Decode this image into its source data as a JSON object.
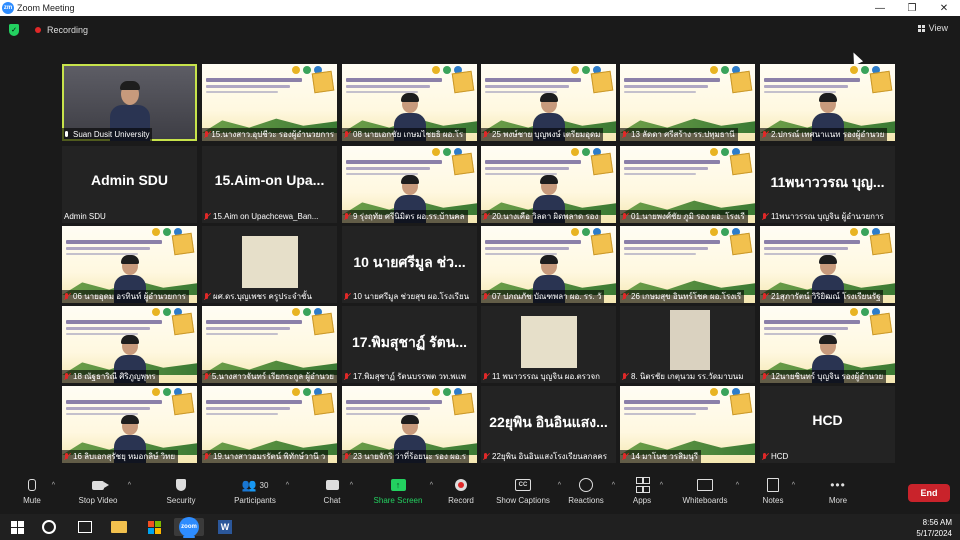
{
  "window": {
    "logo_text": "zm",
    "title": "Zoom Meeting",
    "minimize": "—",
    "restore": "❐",
    "close": "✕"
  },
  "topbar": {
    "recording": "Recording",
    "view": "View"
  },
  "tiles": [
    {
      "type": "cam",
      "big": "",
      "name": "Suan Dusit University",
      "mic": "on",
      "selected": true
    },
    {
      "type": "slide",
      "big": "",
      "name": "15.นางสาว.อุปชีวะ รองผู้อำนวยการ",
      "mic": "off"
    },
    {
      "type": "slide",
      "big": "",
      "name": "08 นายเอกชัย เกษมไชยธิ ผอ.โร",
      "mic": "off"
    },
    {
      "type": "slide",
      "big": "",
      "name": "25 พงษ์ชาย บุญพงษ์ เตรียมอุดม",
      "mic": "off"
    },
    {
      "type": "slide",
      "big": "",
      "name": "13 ลัดดา ศรีสร้าง รร.ปทุมธานี",
      "mic": "off"
    },
    {
      "type": "slide",
      "big": "",
      "name": "2.ปกรณ์ เทศนาแนท รองผู้อำนวย",
      "mic": "off"
    },
    {
      "type": "dark",
      "big": "Admin SDU",
      "name": "Admin SDU",
      "mic": "none"
    },
    {
      "type": "dark",
      "big": "15.Aim-on Upa...",
      "name": "15.Aim on Upachcewa_Ban...",
      "mic": "off"
    },
    {
      "type": "slide",
      "big": "",
      "name": "9 รุ่งฤทัย ศรีนิมิตร ผอ.รร.บ้านคล",
      "mic": "off"
    },
    {
      "type": "slide",
      "big": "",
      "name": "20.นางเคือ วิลดา ผิดพลาด รอง",
      "mic": "off"
    },
    {
      "type": "slide",
      "big": "",
      "name": "01.นายพงศ์ชัย ภูมิ รอง ผอ. โรงเรี",
      "mic": "off"
    },
    {
      "type": "dark",
      "big": "11พนาววรณ บุญ...",
      "name": "11พนาวรรณ บุญจิน ผู้อำนวยการ",
      "mic": "off"
    },
    {
      "type": "slide",
      "big": "",
      "name": "06 นายอุดม อรทินท์ ผู้อำนวยการ",
      "mic": "off"
    },
    {
      "type": "dark",
      "big": "",
      "name": "ผศ.ดร.บุญเพชร ครูประจำชั้น",
      "mic": "off",
      "inset": true
    },
    {
      "type": "dark",
      "big": "10 นายศรีมูล ช่ว...",
      "name": "10 นายศรีมูล ช่วยสุข ผอ.โรงเรียน",
      "mic": "off"
    },
    {
      "type": "slide",
      "big": "",
      "name": "07 ปภณภัช บัณฑพลา ผอ. รร. วั",
      "mic": "off"
    },
    {
      "type": "slide",
      "big": "",
      "name": "26 เกษมสุข อินทร์โชค ผอ.โรงเรี",
      "mic": "off"
    },
    {
      "type": "slide",
      "big": "",
      "name": "21สุภารัตน์ วิริยิฒณ์ โรงเรียนรัฐ",
      "mic": "off"
    },
    {
      "type": "slide",
      "big": "",
      "name": "18 ณัฐธาริณี ศิริภูญพุทร",
      "mic": "off"
    },
    {
      "type": "slide",
      "big": "",
      "name": "5.นางสาวจันทร์ เรียกระกูล ผู้อำนวย",
      "mic": "off"
    },
    {
      "type": "dark",
      "big": "17.พิมสุชาฏ์ รัตน...",
      "name": "17.พิมสุชาฏ์ รัตนบรรพต วท.พแพ",
      "mic": "off"
    },
    {
      "type": "dark",
      "big": "",
      "name": "11 พนาวรรณ บุญจิน ผอ.ตรวจก",
      "mic": "off",
      "inset": true
    },
    {
      "type": "dark",
      "big": "",
      "name": "8. นิตรชัย เกตุนวม รร.วัดมาบนม",
      "mic": "off",
      "inset_small": true
    },
    {
      "type": "slide",
      "big": "",
      "name": "12นายชินทร์ บุญจิน รองผู้อำนวย",
      "mic": "off"
    },
    {
      "type": "slide",
      "big": "",
      "name": "16 ลิบเอกสุรัชยุ หมอกลิษ์ วิทย",
      "mic": "off"
    },
    {
      "type": "slide",
      "big": "",
      "name": "19.นางสาวอมรรัตน์ พิทักษ์วานี ว",
      "mic": "off"
    },
    {
      "type": "slide",
      "big": "",
      "name": "23 นายจักริ ว่าที่ร้อยนะ รอง ผอ.ร",
      "mic": "off"
    },
    {
      "type": "dark",
      "big": "22ยุพิน อินอินแสง...",
      "name": "22ยุพิน อินอินแสงโรงเรียนลกลคร",
      "mic": "off"
    },
    {
      "type": "slide",
      "big": "",
      "name": "14 มาโนช วรสิมนุรี",
      "mic": "off"
    },
    {
      "type": "dark",
      "big": "HCD",
      "name": "HCD",
      "mic": "off"
    }
  ],
  "toolbar": {
    "mute": "Mute",
    "stop_video": "Stop Video",
    "security": "Security",
    "participants": "Participants",
    "participants_count": "30",
    "chat": "Chat",
    "share_screen": "Share Screen",
    "record": "Record",
    "show_captions": "Show Captions",
    "captions_icon": "CC",
    "reactions": "Reactions",
    "apps": "Apps",
    "whiteboards": "Whiteboards",
    "notes": "Notes",
    "more": "More",
    "end": "End"
  },
  "taskbar": {
    "zoom_text": "zoom",
    "word_text": "W",
    "time": "8:56 AM",
    "date": "5/17/2024"
  }
}
